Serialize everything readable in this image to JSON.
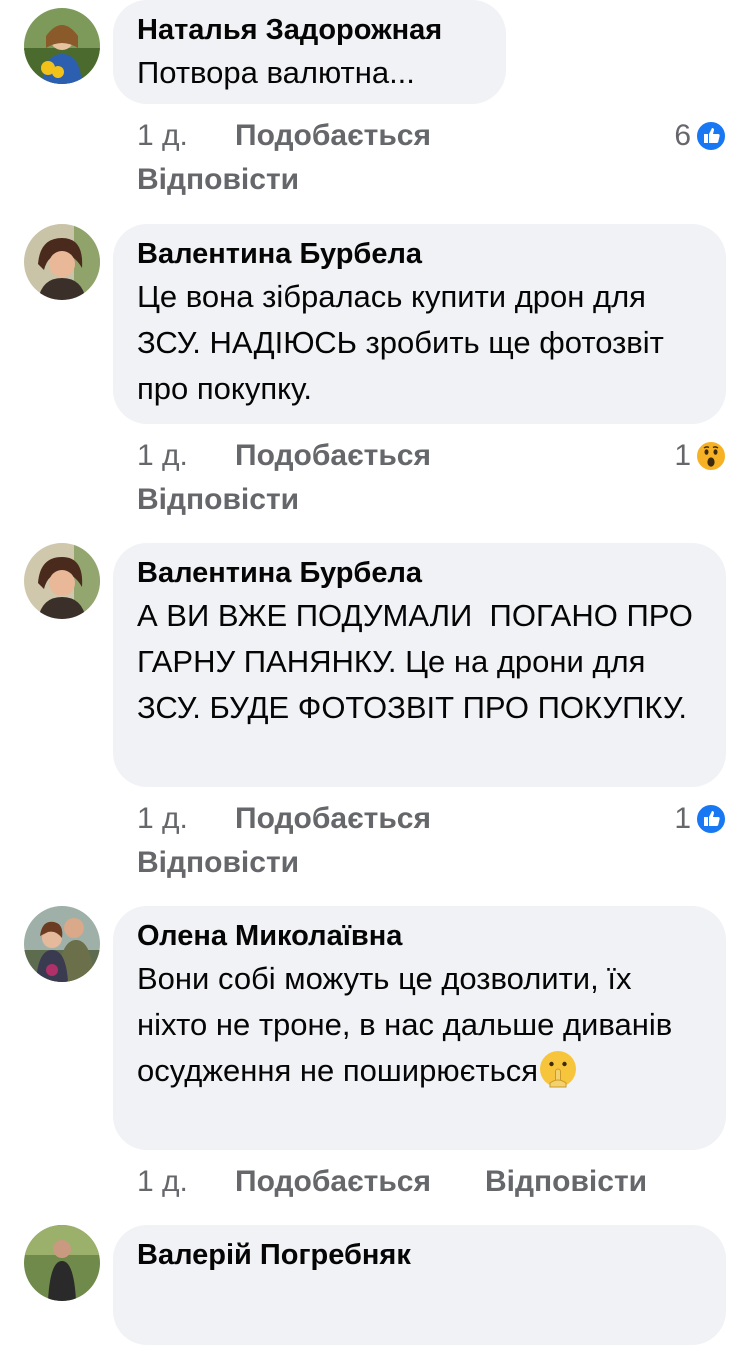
{
  "comments": [
    {
      "author": "Наталья Задорожная",
      "text": "Потвора валютна...",
      "time": "1 д.",
      "like_label": "Подобається",
      "reply_label": "Відповісти",
      "reaction": {
        "count": "6",
        "type": "like-icon",
        "color": "#1877f2"
      }
    },
    {
      "author": "Валентина Бурбела",
      "text": "Це вона зібралась купити дрон для ЗСУ. НАДІЮСЬ зробить ще фотозвіт про покупку.",
      "time": "1 д.",
      "like_label": "Подобається",
      "reply_label": "Відповісти",
      "reaction": {
        "count": "1",
        "type": "wow-icon",
        "color": "#f7b125"
      }
    },
    {
      "author": "Валентина Бурбела",
      "text": "А ВИ ВЖЕ ПОДУМАЛИ  ПОГАНО ПРО ГАРНУ ПАНЯНКУ. Це на дрони для ЗСУ. БУДЕ ФОТОЗВІТ ПРО ПОКУПКУ.",
      "time": "1 д.",
      "like_label": "Подобається",
      "reply_label": "Відповісти",
      "reaction": {
        "count": "1",
        "type": "like-icon",
        "color": "#1877f2"
      }
    },
    {
      "author": "Олена Миколаївна",
      "text": "Вони собі можуть це дозволити, їх ніхто не троне, в нас дальше диванів осудження не поширюється",
      "emoji": "shushing-face-icon",
      "time": "1 д.",
      "like_label": "Подобається",
      "reply_label": "Відповісти"
    },
    {
      "author": "Валерій Погребняк"
    }
  ],
  "colors": {
    "bubble": "#f0f2f5",
    "secondary_text": "#65676b",
    "like_blue": "#1877f2"
  }
}
